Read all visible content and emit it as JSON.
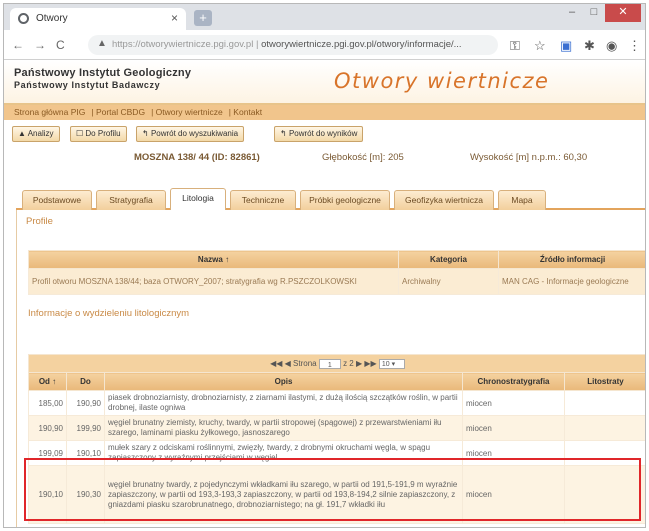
{
  "browser": {
    "tab_title": "Otwory",
    "new_tab": "+",
    "url_prefix": "https://otworywiertnicze.pgi.gov.pl",
    "url_main": "otworywiertnicze.pgi.gov.pl/otwory/informacje/...",
    "window_controls": [
      "–",
      "□",
      "✕"
    ]
  },
  "header": {
    "org_line1": "Państwowy Instytut Geologiczny",
    "org_line2": "Państwowy Instytut Badawczy",
    "app_title": "Otwory wiertnicze"
  },
  "breadcrumb": [
    "Strona główna PIG",
    "Portal CBDG",
    "Otwory wiertnicze",
    "Kontakt"
  ],
  "toolbar": {
    "btn1": "Analizy",
    "btn2": "Do Profilu",
    "btn3": "Powrót do wyszukiwania",
    "btn4": "Powrót do wyników"
  },
  "infoline": {
    "name": "MOSZNA 138/ 44 (ID: 82861)",
    "depth": "Głębokość [m]: 205",
    "altitude": "Wysokość [m] n.p.m.: 60,30"
  },
  "tabs": [
    "Podstawowe",
    "Stratygrafia",
    "Litologia",
    "Techniczne",
    "Próbki geologiczne",
    "Geofizyka wiertnicza",
    "Mapa"
  ],
  "profile_section": {
    "title": "Profile",
    "columns": [
      "Nazwa",
      "Kategoria",
      "Źródło informacji"
    ],
    "row": {
      "name": "Profil otworu MOSZNA 138/44; baza OTWORY_2007; stratygrafia wg R.PSZCZOLKOWSKI",
      "category": "Archiwalny",
      "source": "MAN CAG - Informacje geologiczne"
    }
  },
  "lithology_section": {
    "title": "Informacje o wydzieleniu litologicznym",
    "pager": {
      "label": "Strona",
      "page": "1",
      "of": "z 2",
      "page_size": "10"
    },
    "columns": [
      "Od",
      "Do",
      "Opis",
      "Chronostratygrafia",
      "Litostraty"
    ],
    "rows": [
      {
        "od": "185,00",
        "do": "190,90",
        "opis": "piasek drobnoziarnisty, drobnoziarnisty, z ziarnami ilastymi, z dużą ilością szczątków roślin, w partii drobnej, ilaste ogniwa",
        "chrono": "miocen"
      },
      {
        "od": "190,90",
        "do": "199,90",
        "opis": "węgiel brunatny ziemisty, kruchy, twardy, w partii stropowej (spągowej) z przewarstwieniami iłu szarego, laminami piasku żyłkowego, jasnoszarego",
        "chrono": "miocen"
      },
      {
        "od": "199,09",
        "do": "190,10",
        "opis": "mułek szary z odciskami roślinnymi, zwięzły, twardy, z drobnymi okruchami węgla, w spągu zapiaszczony z wyraźnymi przejściami w węgiel",
        "chrono": "miocen"
      },
      {
        "od": "190,10",
        "do": "190,30",
        "opis": "węgiel brunatny twardy, z pojedynczymi wkładkami iłu szarego, w partii od 191,5-191,9 m wyraźnie zapiaszczony, w partii od 193,3-193,3 zapiaszczony, w partii od 193,8-194,2 silnie zapiaszczony, z gniazdami piasku szarobrunatnego, drobnoziarnistego; na gł. 191,7 wkładki iłu",
        "chrono": "miocen"
      }
    ]
  },
  "colors": {
    "accent": "#d8742a",
    "tab_border": "#e3a45c",
    "highlight": "#e0262a"
  }
}
